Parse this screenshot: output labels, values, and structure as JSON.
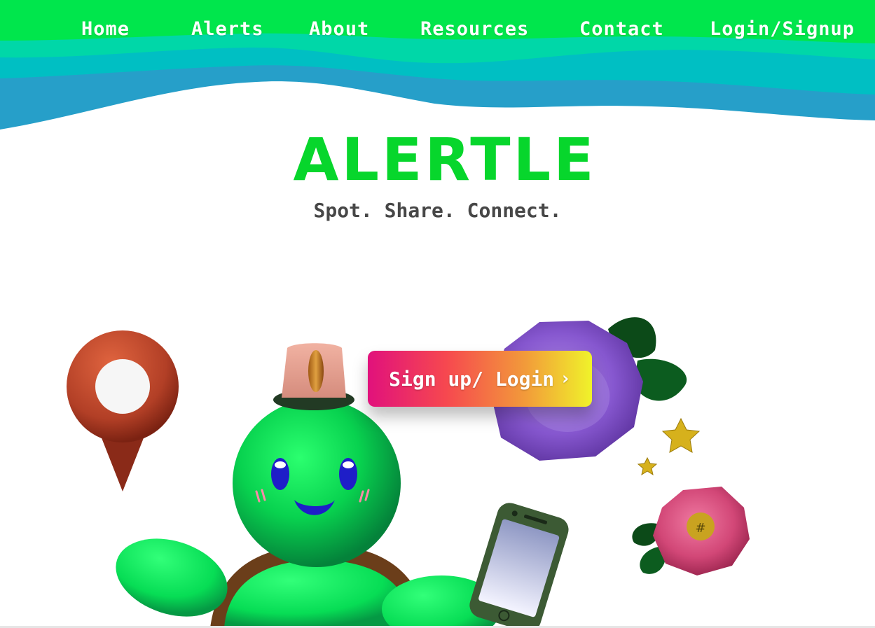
{
  "nav": {
    "items": [
      {
        "label": "Home"
      },
      {
        "label": "Alerts"
      },
      {
        "label": "About"
      },
      {
        "label": "Resources"
      },
      {
        "label": "Contact"
      },
      {
        "label": "Login/Signup"
      }
    ]
  },
  "brand": {
    "name": "ALERTLE",
    "tagline": "Spot. Share. Connect."
  },
  "cta": {
    "label": "Sign up/ Login",
    "chevron": "›"
  },
  "colors": {
    "nav_green": "#00e64c",
    "wave_teal": "#00c7c0",
    "wave_blue": "#2a9fc9",
    "logo_green": "#07d62c",
    "tagline_gray": "#474747",
    "mascot_green": "#05e651",
    "pin_red": "#b6402b",
    "flower_purple": "#8a5ad0",
    "flower_pink": "#d34a7a",
    "star_gold": "#d6b11c"
  },
  "icons": [
    "map-pin-icon",
    "chevron-right-icon",
    "star-icon",
    "phone-icon",
    "flower-icon"
  ]
}
